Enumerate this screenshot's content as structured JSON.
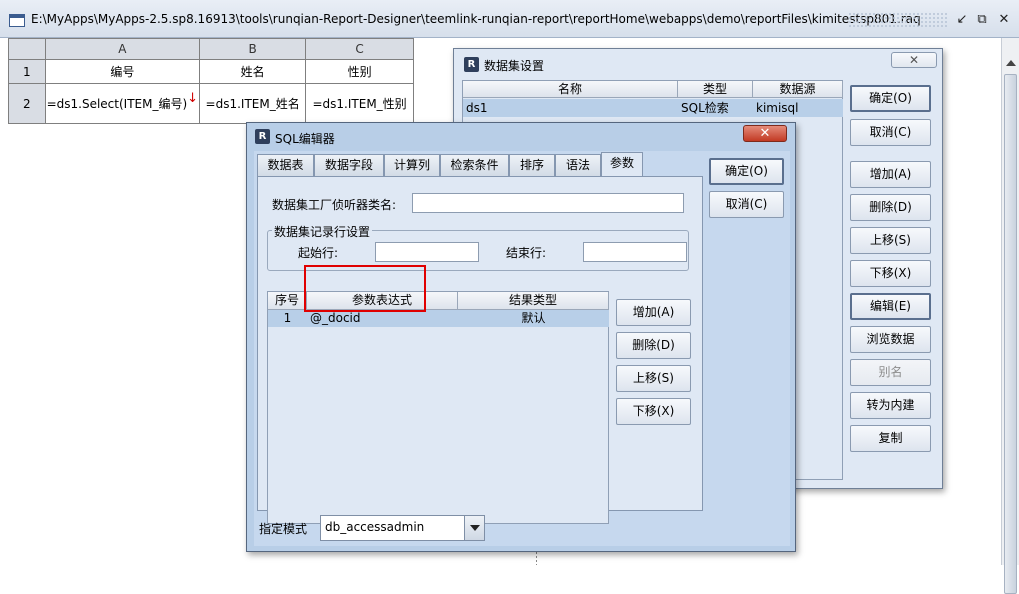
{
  "window": {
    "title": "E:\\MyApps\\MyApps-2.5.sp8.16913\\tools\\runqian-Report-Designer\\teemlink-runqian-report\\reportHome\\webapps\\demo\\reportFiles\\kimitestsp801.raq",
    "controls": [
      "↙",
      "⧉",
      "✕"
    ]
  },
  "sheet": {
    "columns": [
      "A",
      "B",
      "C"
    ],
    "rows": [
      {
        "num": "1",
        "cells": [
          "编号",
          "姓名",
          "性别"
        ]
      },
      {
        "num": "2",
        "cells": [
          "=ds1.Select(ITEM_编号)",
          "=ds1.ITEM_姓名",
          "=ds1.ITEM_性别"
        ],
        "marker": "↓"
      }
    ]
  },
  "dataset_dialog": {
    "title": "数据集设置",
    "close": "✕",
    "headers": [
      "名称",
      "类型",
      "数据源"
    ],
    "rows": [
      [
        "ds1",
        "SQL检索",
        "kimisql"
      ]
    ],
    "buttons": [
      "确定(O)",
      "取消(C)",
      "增加(A)",
      "删除(D)",
      "上移(S)",
      "下移(X)",
      "编辑(E)",
      "浏览数据",
      "别名",
      "转为内建",
      "复制"
    ]
  },
  "sql_dialog": {
    "title": "SQL编辑器",
    "close": "✕",
    "tabs": [
      "数据表",
      "数据字段",
      "计算列",
      "检索条件",
      "排序",
      "语法",
      "参数"
    ],
    "active_tab": "参数",
    "ok": "确定(O)",
    "cancel": "取消(C)",
    "listener_label": "数据集工厂侦听器类名:",
    "listener_value": "",
    "group_title": "数据集记录行设置",
    "start_label": "起始行:",
    "end_label": "结束行:",
    "param_headers": [
      "序号",
      "参数表达式",
      "结果类型"
    ],
    "params": [
      {
        "no": "1",
        "expr": "@_docid",
        "type": "默认"
      }
    ],
    "param_buttons": [
      "增加(A)",
      "删除(D)",
      "上移(S)",
      "下移(X)"
    ],
    "mode_label": "指定模式",
    "mode_value": "db_accessadmin"
  }
}
